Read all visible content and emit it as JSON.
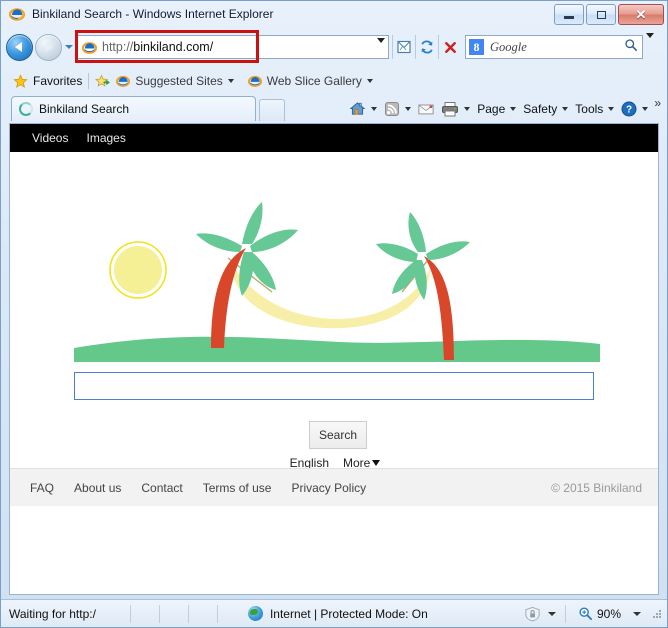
{
  "window": {
    "title": "Binkiland Search - Windows Internet Explorer",
    "icon": "ie-logo-icon",
    "controls": {
      "minimize": "─",
      "maximize": "□",
      "close": "✕"
    }
  },
  "navigation": {
    "back_label": "Back",
    "forward_label": "Forward",
    "recent_pages_label": "Recent Pages",
    "address": {
      "protocol": "http://",
      "host": "binkiland.com/",
      "full": "http://binkiland.com/"
    },
    "compatibility_label": "Compatibility View",
    "refresh_label": "Refresh",
    "stop_label": "Stop",
    "search_provider": "Google",
    "search_badge": "8",
    "search_placeholder": "Google"
  },
  "favorites_bar": {
    "favorites_label": "Favorites",
    "items": [
      {
        "label": "Suggested Sites",
        "icon": "ie-icon",
        "has_caret": true
      },
      {
        "label": "Web Slice Gallery",
        "icon": "ie-icon",
        "has_caret": true
      }
    ]
  },
  "tabs": [
    {
      "label": "Binkiland Search",
      "icon": "loading-spinner-icon",
      "active": true
    }
  ],
  "new_tab_label": "",
  "command_bar": {
    "items": [
      {
        "label": "",
        "icon": "home-icon",
        "has_caret": true
      },
      {
        "label": "",
        "icon": "feeds-icon",
        "has_caret": true
      },
      {
        "label": "",
        "icon": "mail-icon",
        "has_caret": false
      },
      {
        "label": "",
        "icon": "print-icon",
        "has_caret": true
      },
      {
        "label": "Page",
        "icon": "",
        "has_caret": true
      },
      {
        "label": "Safety",
        "icon": "",
        "has_caret": true
      },
      {
        "label": "Tools",
        "icon": "",
        "has_caret": true
      },
      {
        "label": "",
        "icon": "help-icon",
        "has_caret": true
      }
    ],
    "overflow": "»"
  },
  "page": {
    "site_nav": [
      "Videos",
      "Images"
    ],
    "illustration": {
      "name": "beach-hammock-illustration",
      "colors": {
        "sun_fill": "#f5ef95",
        "sun_ring": "#f2e31e",
        "leaf": "#65c895",
        "trunk": "#d9472b",
        "hammock": "#f7efa8",
        "ground": "#63c88a",
        "rope": "#b9a96a"
      }
    },
    "search_value": "",
    "search_placeholder": "",
    "search_button": "Search",
    "language": "English",
    "more_label": "More",
    "footer_links": [
      "FAQ",
      "About us",
      "Contact",
      "Terms of use",
      "Privacy Policy"
    ],
    "copyright": "© 2015 Binkiland"
  },
  "status_bar": {
    "message": "Waiting for http:/",
    "zone": "Internet | Protected Mode: On",
    "zone_icon": "internet-globe-icon",
    "security_icon": "protected-mode-icon",
    "zoom_level": "90%",
    "zoom_icon": "zoom-magnifier-icon"
  }
}
